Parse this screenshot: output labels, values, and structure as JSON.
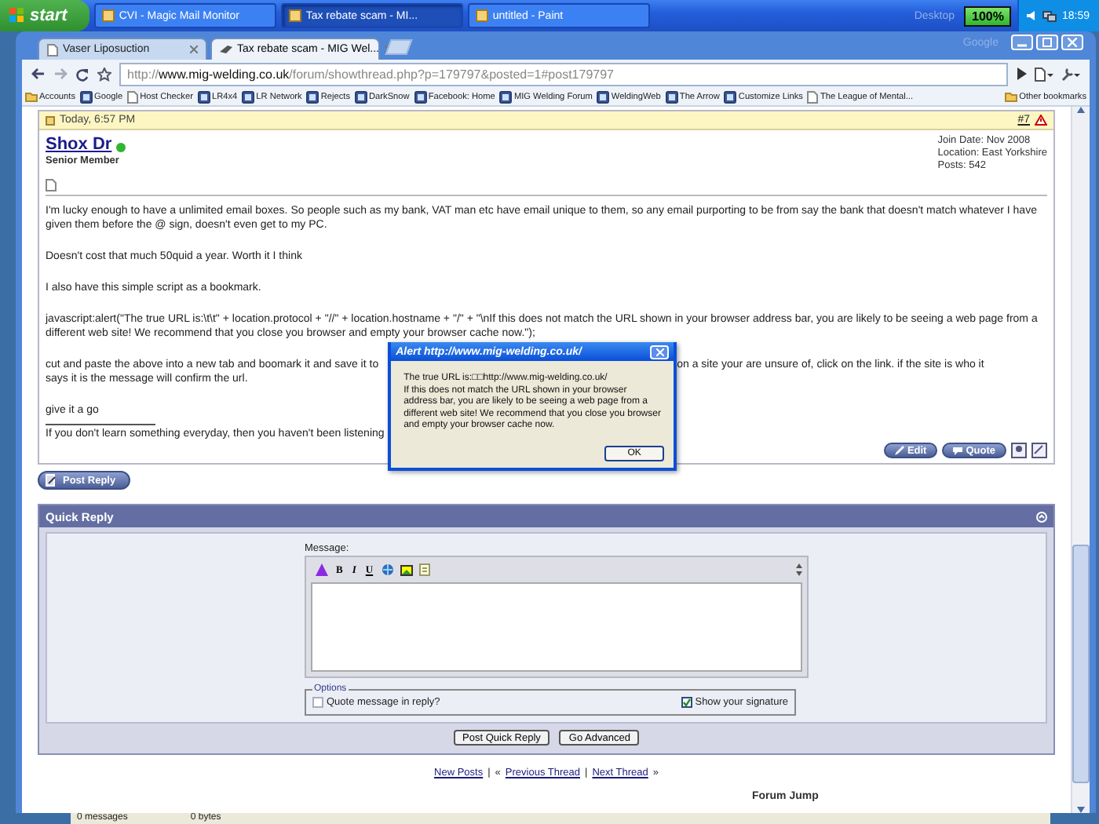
{
  "taskbar": {
    "start": "start",
    "tasks": [
      {
        "label": "CVI - Magic Mail Monitor",
        "selected": false
      },
      {
        "label": "Tax rebate scam - MI...",
        "selected": true
      },
      {
        "label": "untitled - Paint",
        "selected": false
      }
    ],
    "desktop": "Desktop",
    "battery": "100%",
    "clock": "18:59"
  },
  "browser": {
    "corner_label": "Google",
    "tabs": [
      {
        "label": "Vaser Liposuction",
        "selected": false
      },
      {
        "label": "Tax rebate scam - MIG Wel...",
        "selected": true
      }
    ],
    "address": {
      "scheme": "http://",
      "host": "www.mig-welding.co.uk",
      "path": "/forum/showthread.php?p=179797&posted=1#post179797"
    },
    "bookmarks": [
      {
        "label": "Accounts",
        "kind": "folder"
      },
      {
        "label": "Google",
        "kind": "site"
      },
      {
        "label": "Host Checker",
        "kind": "page"
      },
      {
        "label": "LR4x4",
        "kind": "site"
      },
      {
        "label": "LR Network",
        "kind": "site"
      },
      {
        "label": "Rejects",
        "kind": "site"
      },
      {
        "label": "DarkSnow",
        "kind": "site"
      },
      {
        "label": "Facebook: Home",
        "kind": "site"
      },
      {
        "label": "MIG Welding Forum",
        "kind": "site"
      },
      {
        "label": "WeldingWeb",
        "kind": "site"
      },
      {
        "label": "The Arrow",
        "kind": "site"
      },
      {
        "label": "Customize Links",
        "kind": "site"
      },
      {
        "label": "The League of Mental...",
        "kind": "page"
      }
    ],
    "other_bookmarks": "Other bookmarks"
  },
  "post": {
    "date": "Today, 6:57 PM",
    "number": "#7",
    "author": "Shox Dr",
    "online": true,
    "rank": "Senior Member",
    "info": [
      "Join Date: Nov 2008",
      "Location: East Yorkshire",
      "Posts: 542"
    ],
    "paragraphs": [
      "I'm lucky enough to have a unlimited email boxes. So people such as my bank, VAT man etc have email unique to them, so any email purporting to be from say the bank that doesn't match whatever I have given them before the @ sign, doesn't even get to my PC.",
      "Doesn't cost that much 50quid a year. Worth it I think",
      "I also have this simple script as a bookmark.",
      "javascript:alert(\"The true URL is:\\t\\t\" + location.protocol + \"//\" + location.hostname + \"/\" + \"\\nIf this does not match the URL shown in your browser address bar, you are likely to be seeing a web page from a different web site! We recommend that you close you browser and empty your browser cache now.\");"
    ],
    "covered_paragraph": {
      "before": "cut and paste the above into a new tab and boomark it and save it to",
      "after": "on a site your are unsure of, click on the link. if the site is who it",
      "continued": "says it is the message will confirm the url."
    },
    "closing": "give it a go",
    "signature": "If you don't learn something everyday, then you haven't been listening",
    "buttons": [
      "Edit",
      "Quote"
    ]
  },
  "alert": {
    "title": "Alert http://www.mig-welding.co.uk/",
    "first_line": "The true URL is:□□http://www.mig-welding.co.uk/",
    "message": "If this does not match the URL shown in your browser address bar, you are likely to be seeing a web page from a different web site! We recommend that you close you browser and empty your browser cache now.",
    "button": "OK"
  },
  "post_reply": "Post Reply",
  "quick_reply": {
    "title": "Quick Reply",
    "message_label": "Message:",
    "format_buttons": [
      "B",
      "I",
      "U"
    ],
    "options_legend": "Options",
    "options": [
      {
        "label": "Quote message in reply?",
        "checked": false
      },
      {
        "label": "Show your signature",
        "checked": true
      }
    ],
    "buttons": [
      "Post Quick Reply",
      "Go Advanced"
    ]
  },
  "thread_nav": [
    {
      "kind": "link",
      "text": "New Posts"
    },
    {
      "kind": "sep",
      "text": "|"
    },
    {
      "kind": "sep",
      "text": "«"
    },
    {
      "kind": "link",
      "text": "Previous Thread"
    },
    {
      "kind": "sep",
      "text": "|"
    },
    {
      "kind": "link",
      "text": "Next Thread"
    },
    {
      "kind": "sep",
      "text": "»"
    }
  ],
  "forum_jump": "Forum Jump",
  "background_window": {
    "messages": "0 messages",
    "size": "0 bytes"
  }
}
